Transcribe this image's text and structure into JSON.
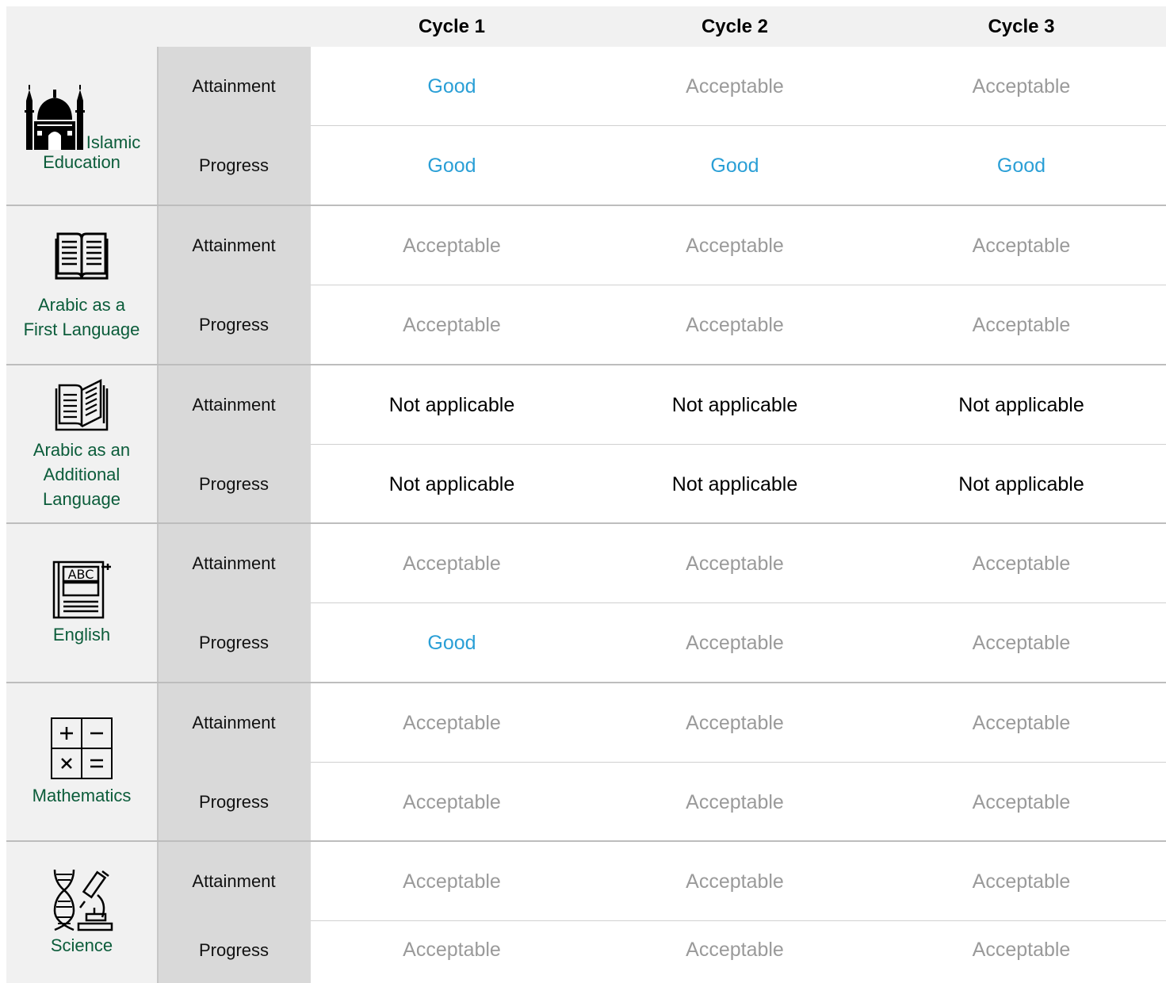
{
  "header": {
    "cycles": [
      "Cycle 1",
      "Cycle 2",
      "Cycle 3"
    ]
  },
  "row_types": {
    "attainment": "Attainment",
    "progress": "Progress"
  },
  "subjects": [
    {
      "name": "Islamic Education",
      "label_lines": [
        "Islamic",
        "Education"
      ],
      "icon": "mosque-icon",
      "attainment": [
        "Good",
        "Acceptable",
        "Acceptable"
      ],
      "progress": [
        "Good",
        "Good",
        "Good"
      ]
    },
    {
      "name": "Arabic as a First Language",
      "label_lines": [
        "Arabic as a",
        "First Language"
      ],
      "icon": "open-book-icon",
      "attainment": [
        "Acceptable",
        "Acceptable",
        "Acceptable"
      ],
      "progress": [
        "Acceptable",
        "Acceptable",
        "Acceptable"
      ]
    },
    {
      "name": "Arabic as an Additional Language",
      "label_lines": [
        "Arabic as an",
        "Additional",
        "Language"
      ],
      "icon": "book-outline-icon",
      "attainment": [
        "Not applicable",
        "Not applicable",
        "Not applicable"
      ],
      "progress": [
        "Not applicable",
        "Not applicable",
        "Not applicable"
      ]
    },
    {
      "name": "English",
      "label_lines": [
        "English"
      ],
      "icon": "abc-book-icon",
      "attainment": [
        "Acceptable",
        "Acceptable",
        "Acceptable"
      ],
      "progress": [
        "Good",
        "Acceptable",
        "Acceptable"
      ]
    },
    {
      "name": "Mathematics",
      "label_lines": [
        "Mathematics"
      ],
      "icon": "calculator-symbols-icon",
      "attainment": [
        "Acceptable",
        "Acceptable",
        "Acceptable"
      ],
      "progress": [
        "Acceptable",
        "Acceptable",
        "Acceptable"
      ]
    },
    {
      "name": "Science",
      "label_lines": [
        "Science"
      ],
      "icon": "dna-microscope-icon",
      "attainment": [
        "Acceptable",
        "Acceptable",
        "Acceptable"
      ],
      "progress": [
        "Acceptable",
        "Acceptable",
        "Acceptable"
      ]
    }
  ],
  "colors": {
    "good": "#2a9fd6",
    "acceptable": "#9a9a9a",
    "not_applicable": "#000000",
    "subject_label": "#0b5c3a"
  }
}
